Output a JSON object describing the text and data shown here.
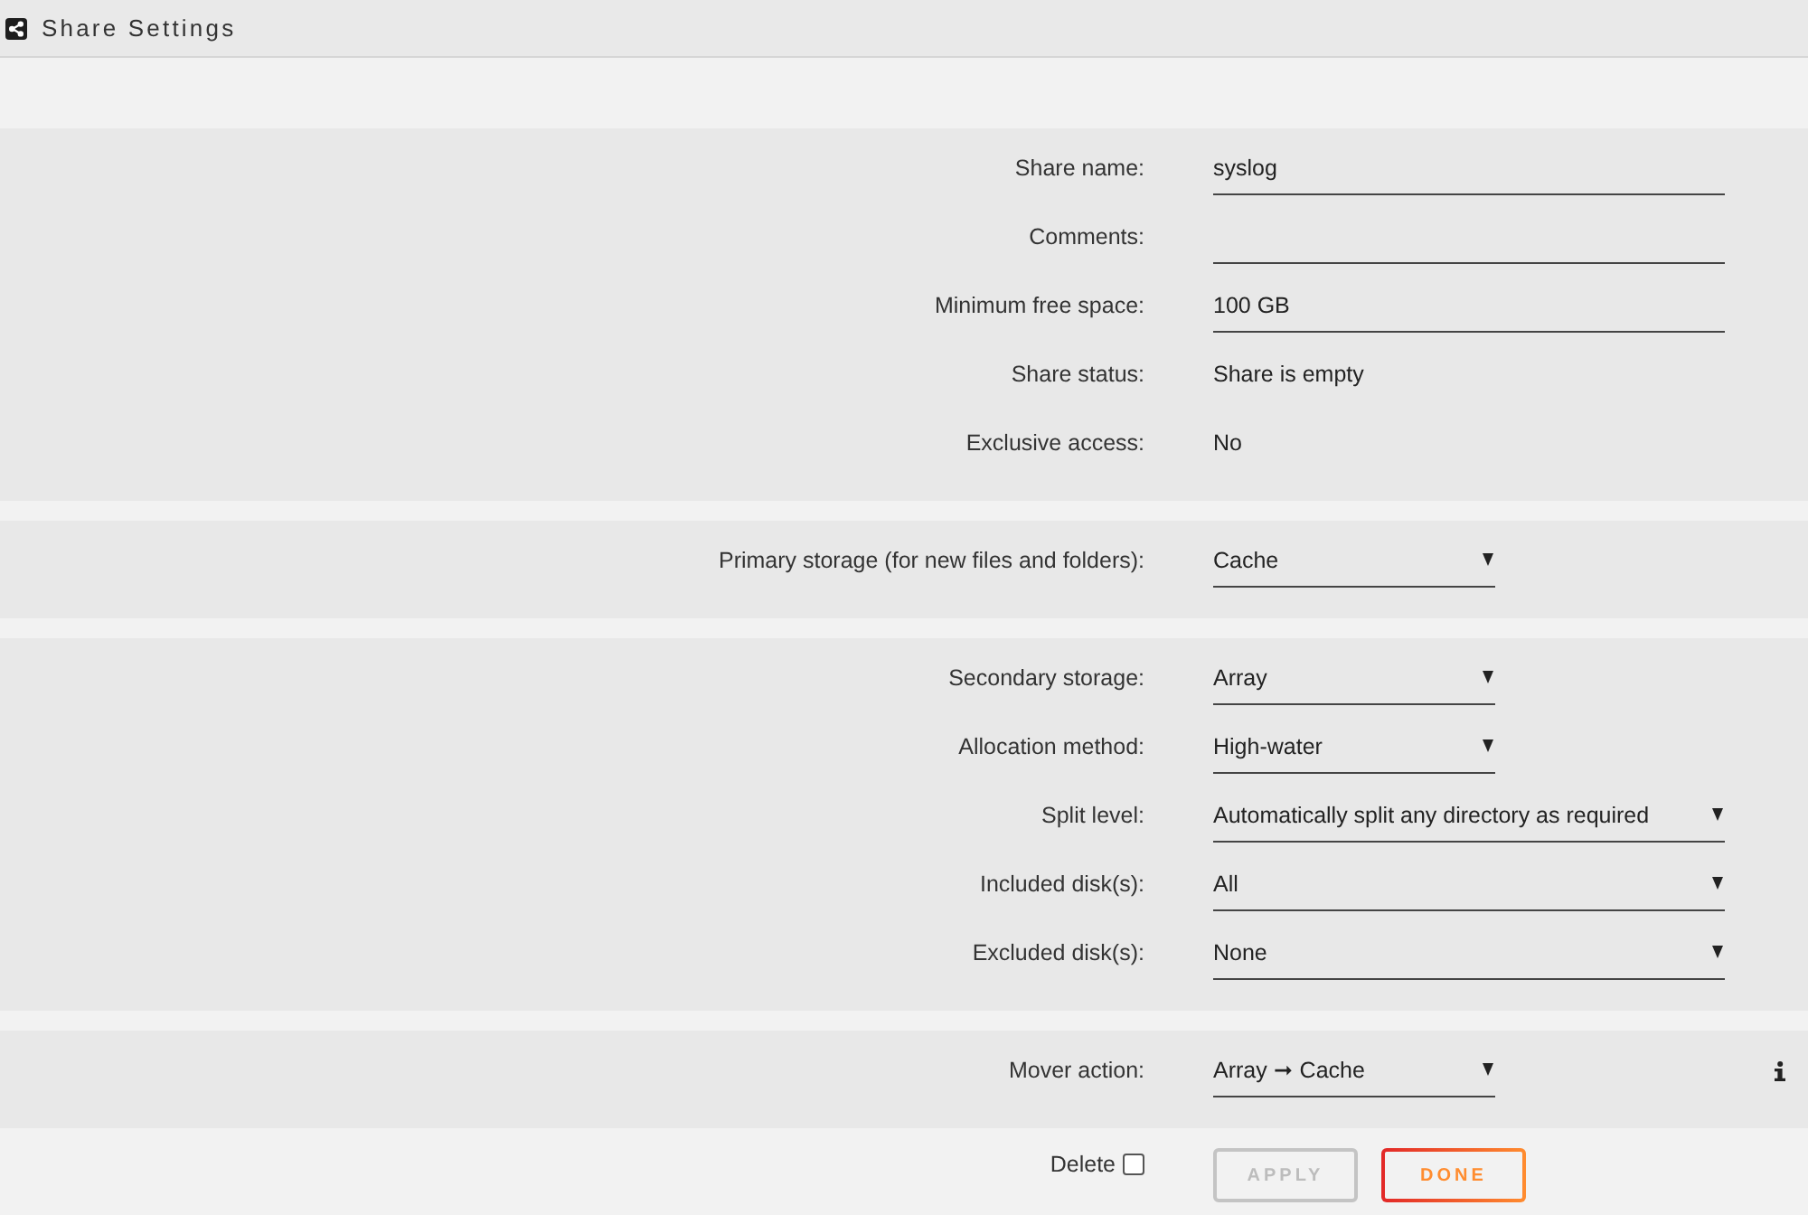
{
  "header": {
    "title": "Share Settings"
  },
  "sections": [
    {
      "rows": [
        {
          "label": "Share name:",
          "kind": "input",
          "value": "syslog"
        },
        {
          "label": "Comments:",
          "kind": "input"
        },
        {
          "label": "Minimum free space:",
          "kind": "input",
          "value": "100 GB"
        },
        {
          "label": "Share status:",
          "kind": "text",
          "value": "Share is empty"
        },
        {
          "label": "Exclusive access:",
          "kind": "text",
          "value": "No"
        }
      ]
    },
    {
      "rows": [
        {
          "label": "Primary storage (for new files and folders):",
          "kind": "select",
          "value": "Cache"
        }
      ]
    },
    {
      "rows": [
        {
          "label": "Secondary storage:",
          "kind": "select",
          "value": "Array"
        },
        {
          "label": "Allocation method:",
          "kind": "select",
          "value": "High-water"
        },
        {
          "label": "Split level:",
          "kind": "wideselect",
          "value": "Automatically split any directory as required"
        },
        {
          "label": "Included disk(s):",
          "kind": "wideselect",
          "value": "All"
        },
        {
          "label": "Excluded disk(s):",
          "kind": "wideselect",
          "value": "None"
        }
      ]
    },
    {
      "rows": [
        {
          "label": "Mover action:",
          "kind": "select",
          "value": "Array ➞ Cache",
          "info": true
        }
      ]
    }
  ],
  "footer": {
    "delete": {
      "label": "Delete",
      "checked": false
    },
    "buttons": [
      {
        "label": "APPLY",
        "disabled": true
      },
      {
        "label": "DONE",
        "disabled": false
      }
    ]
  }
}
